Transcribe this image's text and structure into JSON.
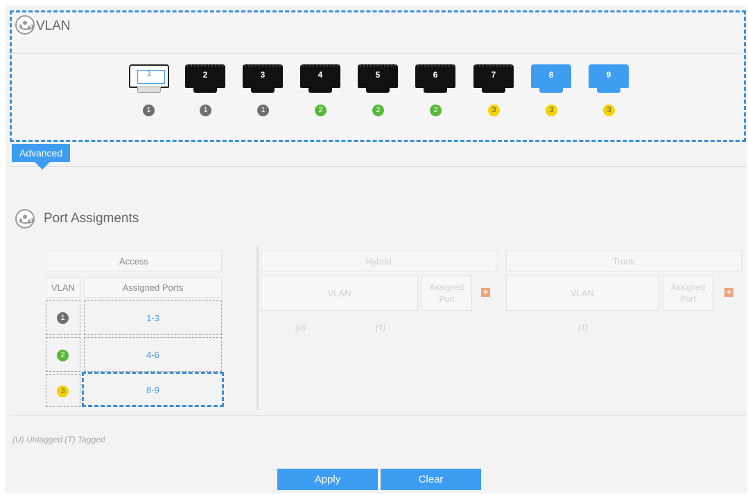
{
  "vlan_section": {
    "title": "VLAN",
    "ports": [
      {
        "label": "1",
        "style": "white",
        "vlan": "1",
        "color": "gray"
      },
      {
        "label": "2",
        "style": "black",
        "vlan": "1",
        "color": "gray"
      },
      {
        "label": "3",
        "style": "black",
        "vlan": "1",
        "color": "gray"
      },
      {
        "label": "4",
        "style": "black",
        "vlan": "2",
        "color": "green"
      },
      {
        "label": "5",
        "style": "black",
        "vlan": "2",
        "color": "green"
      },
      {
        "label": "6",
        "style": "black",
        "vlan": "2",
        "color": "green"
      },
      {
        "label": "7",
        "style": "black",
        "vlan": "3",
        "color": "yellow"
      },
      {
        "label": "8",
        "style": "blue",
        "vlan": "3",
        "color": "yellow"
      },
      {
        "label": "9",
        "style": "blue",
        "vlan": "3",
        "color": "yellow"
      }
    ]
  },
  "advanced_tab": {
    "label": "Advanced"
  },
  "port_assignments": {
    "title": "Port Assigments",
    "access": {
      "header": "Access",
      "col_vlan": "VLAN",
      "col_ports": "Assigned Ports",
      "rows": [
        {
          "vlan": "1",
          "ports": "1-3"
        },
        {
          "vlan": "2",
          "ports": "4-6"
        },
        {
          "vlan": "3",
          "ports": "8-9"
        }
      ]
    },
    "hybrid": {
      "header": "Hybrid",
      "col_vlan": "VLAN",
      "col_ports": "Assigned Port",
      "untagged": "(U)",
      "tagged": "(T)"
    },
    "trunk": {
      "header": "Trunk",
      "col_vlan": "VLAN",
      "col_ports": "Assigned Port",
      "tagged": "(T)"
    },
    "legend": "(U) Untagged (T) Tagged"
  },
  "buttons": {
    "apply": "Apply",
    "clear": "Clear"
  },
  "colors": {
    "accent": "#3d9df0",
    "vlan1": "#6f6f6f",
    "vlan2": "#59b83a",
    "vlan3": "#f5d200",
    "add": "#f0a37c"
  }
}
